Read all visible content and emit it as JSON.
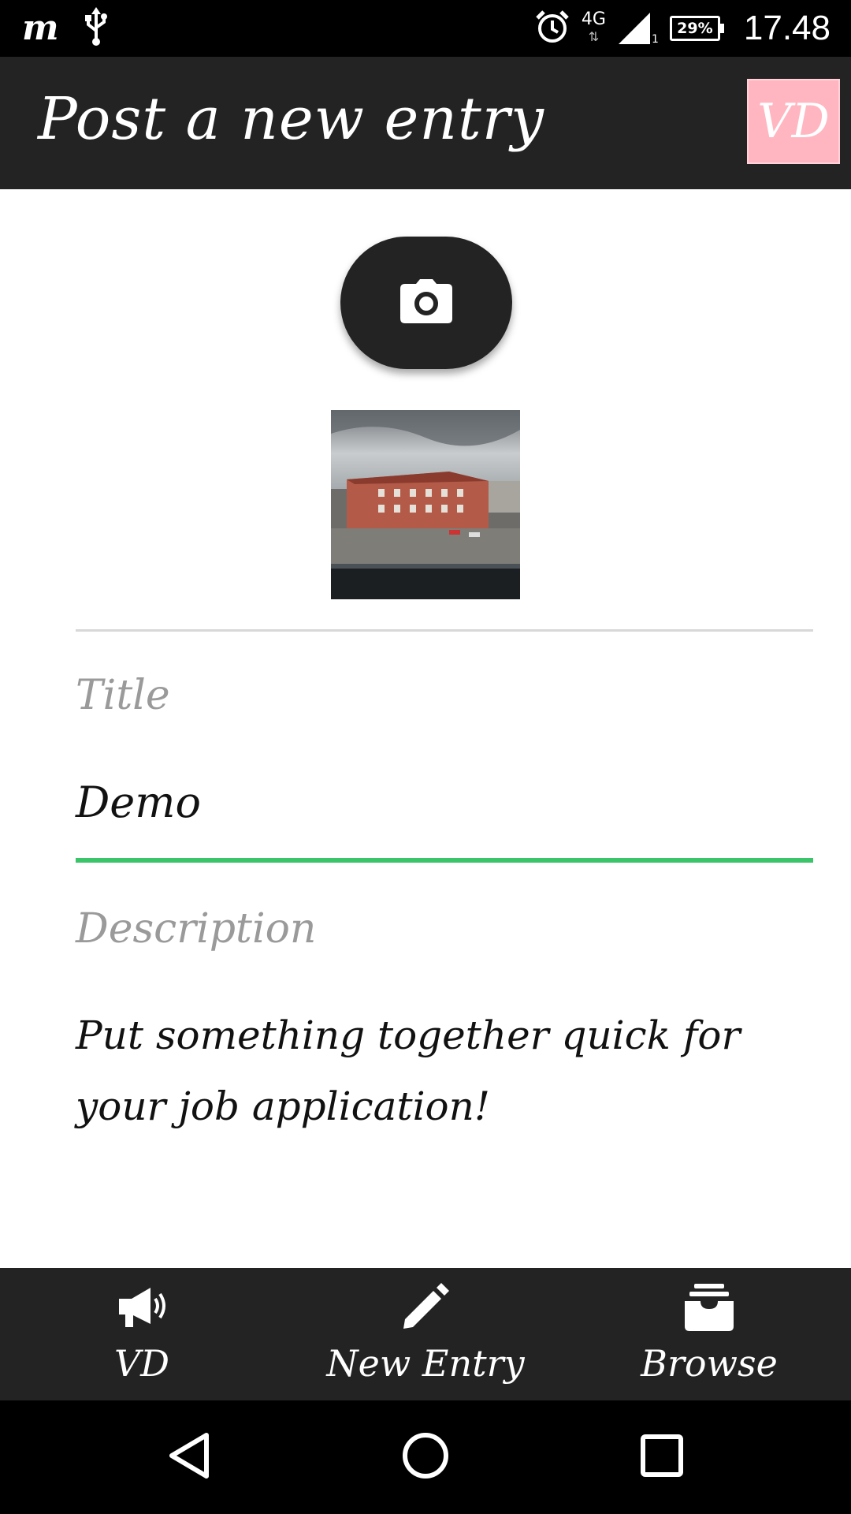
{
  "status_bar": {
    "app_icon": "m",
    "usb_icon": "usb-icon",
    "alarm_icon": "alarm-icon",
    "network": "4G",
    "signal_sub": "1",
    "battery": "29%",
    "time": "17.48"
  },
  "app_bar": {
    "title": "Post a new entry",
    "badge": "VD",
    "badge_color": "#ffb6c1"
  },
  "form": {
    "camera_icon": "camera-icon",
    "title_label": "Title",
    "title_value": "Demo",
    "description_label": "Description",
    "description_value": "Put something together quick for your job application!",
    "accent_color": "#3cc46a"
  },
  "bottom_nav": {
    "items": [
      {
        "label": "VD",
        "icon": "megaphone-icon"
      },
      {
        "label": "New Entry",
        "icon": "pencil-icon"
      },
      {
        "label": "Browse",
        "icon": "inbox-icon"
      }
    ]
  },
  "system_nav": {
    "back_icon": "back-icon",
    "home_icon": "home-icon",
    "recents_icon": "recents-icon"
  }
}
